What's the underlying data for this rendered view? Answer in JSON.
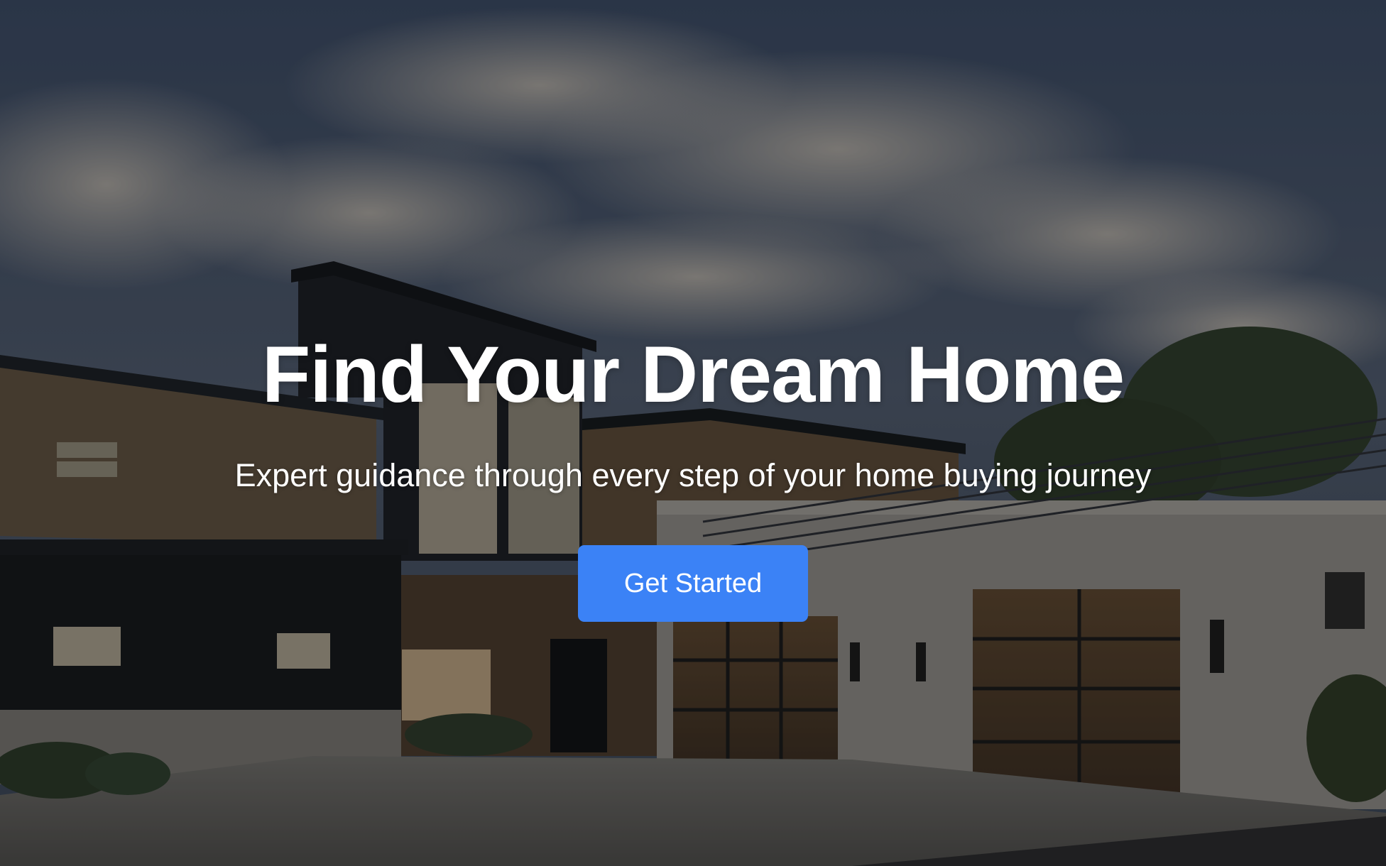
{
  "hero": {
    "title": "Find Your Dream Home",
    "subtitle": "Expert guidance through every step of your home buying journey",
    "cta_label": "Get Started",
    "background_image": "modern-house-at-dusk"
  },
  "colors": {
    "accent": "#3b82f6",
    "text": "#ffffff",
    "sky": "#2a3a55"
  }
}
